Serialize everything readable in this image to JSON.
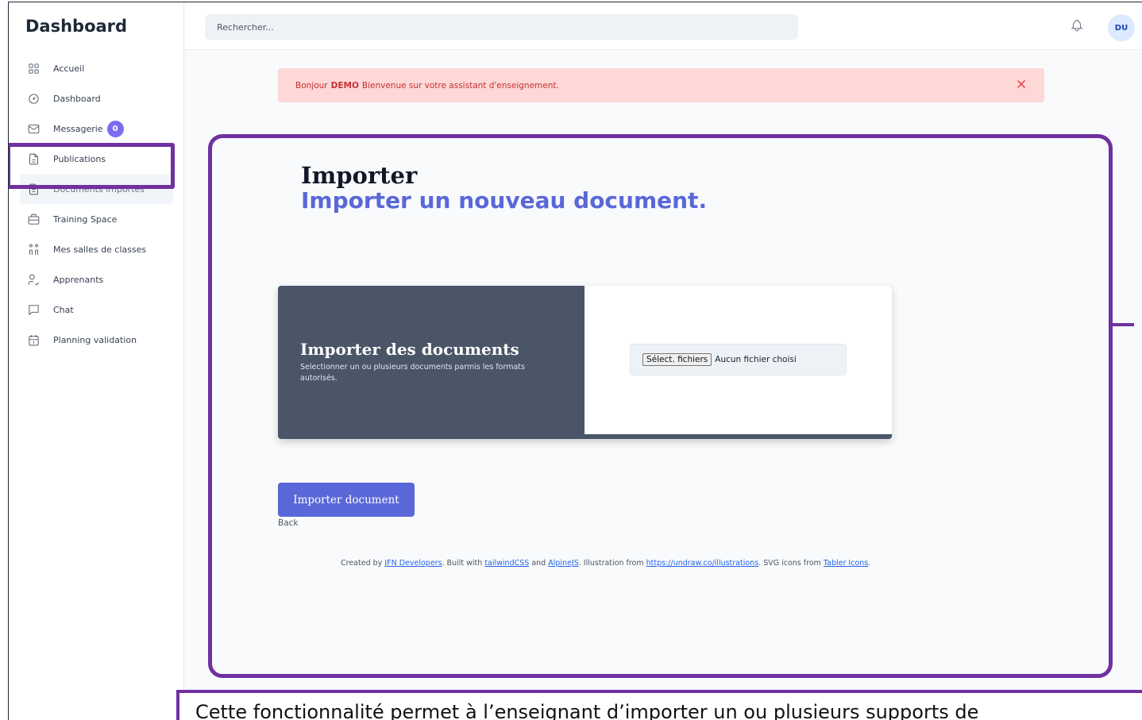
{
  "sidebar": {
    "brand": "Dashboard",
    "items": [
      {
        "label": "Accueil",
        "icon": "grid-icon"
      },
      {
        "label": "Dashboard",
        "icon": "gauge-icon"
      },
      {
        "label": "Messagerie",
        "icon": "mail-icon",
        "badge": "0"
      },
      {
        "label": "Publications",
        "icon": "file-text-icon"
      },
      {
        "label": "Documents importés",
        "icon": "file-icon"
      },
      {
        "label": "Training Space",
        "icon": "briefcase-icon"
      },
      {
        "label": "Mes salles de classes",
        "icon": "users-icon"
      },
      {
        "label": "Apprenants",
        "icon": "user-check-icon"
      },
      {
        "label": "Chat",
        "icon": "message-icon"
      },
      {
        "label": "Planning validation",
        "icon": "calendar-icon"
      }
    ]
  },
  "header": {
    "search_placeholder": "Rechercher...",
    "avatar": "DU"
  },
  "alert": {
    "prefix": "Bonjour",
    "name": "DEMO",
    "message": "Bienvenue sur votre assistant d'enseignement."
  },
  "main": {
    "title": "Importer",
    "subtitle": "Importer un nouveau document.",
    "panel_title": "Importer des documents",
    "panel_desc": "Selectionner un ou plusieurs documents parmis les formats autorisés.",
    "file_button": "Sélect. fichiers",
    "file_status": "Aucun fichier choisi",
    "import_button": "Importer document",
    "back": "Back"
  },
  "footer": {
    "created_by": "Created by",
    "dev_link": "JFN Developers",
    "built_with": ". Built with",
    "tw_link": "tailwindCSS",
    "and": "and",
    "alpine_link": "AlpineJS",
    "illus": ". Illustration from",
    "undraw_link": "https://undraw.co/illustrations",
    "icons": ". SVG icons from",
    "tabler_link": "Tabler Icons",
    "end": "."
  },
  "caption": "Cette fonctionnalité permet à l’enseignant d’importer un ou plusieurs supports de",
  "colors": {
    "accent": "#5a67d8",
    "highlight": "#7030a0",
    "alert_bg": "#fed7d7",
    "panel_bg": "#4a5568"
  }
}
